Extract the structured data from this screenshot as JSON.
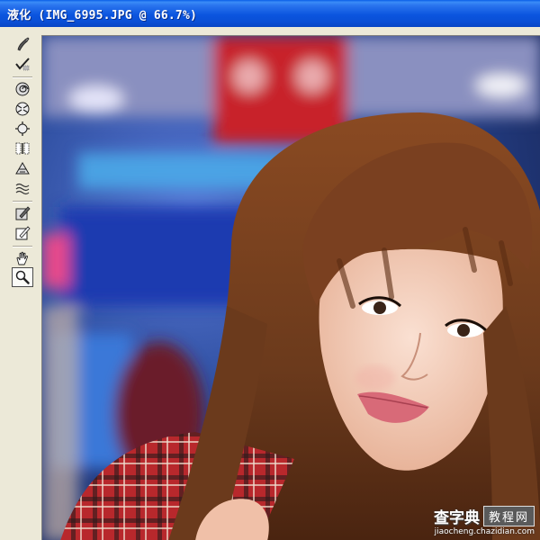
{
  "window": {
    "title": "液化 (IMG_6995.JPG @ 66.7%)"
  },
  "toolbar": {
    "tools": [
      {
        "name": "forward-warp",
        "icon": "forward-warp-icon"
      },
      {
        "name": "reconstruct",
        "icon": "reconstruct-icon"
      },
      {
        "name": "twirl-clockwise",
        "icon": "twirl-icon"
      },
      {
        "name": "pucker",
        "icon": "pucker-icon"
      },
      {
        "name": "bloat",
        "icon": "bloat-icon"
      },
      {
        "name": "push-left",
        "icon": "push-left-icon"
      },
      {
        "name": "mirror",
        "icon": "mirror-icon"
      },
      {
        "name": "turbulence",
        "icon": "turbulence-icon"
      },
      {
        "name": "freeze-mask",
        "icon": "freeze-mask-icon"
      },
      {
        "name": "thaw-mask",
        "icon": "thaw-mask-icon"
      },
      {
        "name": "hand",
        "icon": "hand-icon"
      },
      {
        "name": "zoom",
        "icon": "zoom-icon",
        "selected": true
      }
    ]
  },
  "canvas": {
    "image_description_icon": "photo-portrait",
    "colors": {
      "background_blue": "#2a4a9a",
      "hair": "#6b3a1c",
      "skin": "#f0c8b4",
      "sign_red": "#c8202a",
      "shirt_red": "#b8282c"
    }
  },
  "watermark": {
    "site": "查字典",
    "tag": "教程网",
    "url": "jiaocheng.chazidian.com"
  }
}
